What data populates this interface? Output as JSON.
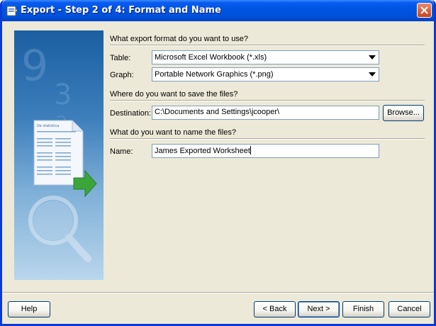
{
  "window": {
    "title": "Export - Step 2 of 4: Format and Name"
  },
  "format_section": {
    "header": "What export format do you want to use?",
    "table_label": "Table:",
    "table_value": "Microsoft Excel Workbook (*.xls)",
    "graph_label": "Graph:",
    "graph_value": "Portable Network Graphics (*.png)"
  },
  "save_section": {
    "header": "Where do you want to save the files?",
    "destination_label": "Destination:",
    "destination_value": "C:\\Documents and Settings\\jcooper\\",
    "browse_label": "Browse..."
  },
  "name_section": {
    "header": "What do you want to name the files?",
    "name_label": "Name:",
    "name_value": "James Exported Worksheet"
  },
  "buttons": {
    "help": "Help",
    "back": "< Back",
    "next": "Next >",
    "finish": "Finish",
    "cancel": "Cancel"
  },
  "side_panel": {
    "doc_heading": "De statistica"
  }
}
